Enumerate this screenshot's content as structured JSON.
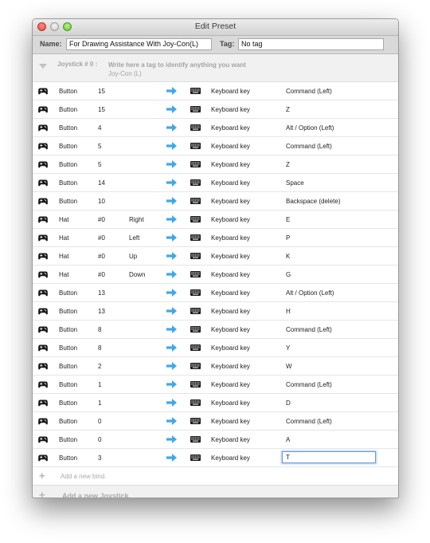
{
  "window": {
    "title": "Edit Preset"
  },
  "preset": {
    "name_label": "Name:",
    "name_value": "For Drawing Assistance With Joy-Con(L)",
    "tag_label": "Tag:",
    "tag_value": "No tag"
  },
  "joystick": {
    "label": "Joystick # 0 :",
    "tag_placeholder": "Write here a tag to identify anything you want",
    "device_name": "Joy-Con (L)"
  },
  "bindings": [
    {
      "type": "Button",
      "number": "15",
      "direction": "",
      "output": "Keyboard key",
      "key": "Command (Left)"
    },
    {
      "type": "Button",
      "number": "15",
      "direction": "",
      "output": "Keyboard key",
      "key": "Z"
    },
    {
      "type": "Button",
      "number": "4",
      "direction": "",
      "output": "Keyboard key",
      "key": "Alt / Option (Left)"
    },
    {
      "type": "Button",
      "number": "5",
      "direction": "",
      "output": "Keyboard key",
      "key": "Command (Left)"
    },
    {
      "type": "Button",
      "number": "5",
      "direction": "",
      "output": "Keyboard key",
      "key": "Z"
    },
    {
      "type": "Button",
      "number": "14",
      "direction": "",
      "output": "Keyboard key",
      "key": "Space"
    },
    {
      "type": "Button",
      "number": "10",
      "direction": "",
      "output": "Keyboard key",
      "key": "Backspace (delete)"
    },
    {
      "type": "Hat",
      "number": "#0",
      "direction": "Right",
      "output": "Keyboard key",
      "key": "E"
    },
    {
      "type": "Hat",
      "number": "#0",
      "direction": "Left",
      "output": "Keyboard key",
      "key": "P"
    },
    {
      "type": "Hat",
      "number": "#0",
      "direction": "Up",
      "output": "Keyboard key",
      "key": "K"
    },
    {
      "type": "Hat",
      "number": "#0",
      "direction": "Down",
      "output": "Keyboard key",
      "key": "G"
    },
    {
      "type": "Button",
      "number": "13",
      "direction": "",
      "output": "Keyboard key",
      "key": "Alt / Option (Left)"
    },
    {
      "type": "Button",
      "number": "13",
      "direction": "",
      "output": "Keyboard key",
      "key": "H"
    },
    {
      "type": "Button",
      "number": "8",
      "direction": "",
      "output": "Keyboard key",
      "key": "Command (Left)"
    },
    {
      "type": "Button",
      "number": "8",
      "direction": "",
      "output": "Keyboard key",
      "key": "Y"
    },
    {
      "type": "Button",
      "number": "2",
      "direction": "",
      "output": "Keyboard key",
      "key": "W"
    },
    {
      "type": "Button",
      "number": "1",
      "direction": "",
      "output": "Keyboard key",
      "key": "Command (Left)"
    },
    {
      "type": "Button",
      "number": "1",
      "direction": "",
      "output": "Keyboard key",
      "key": "D"
    },
    {
      "type": "Button",
      "number": "0",
      "direction": "",
      "output": "Keyboard key",
      "key": "Command (Left)"
    },
    {
      "type": "Button",
      "number": "0",
      "direction": "",
      "output": "Keyboard key",
      "key": "A"
    },
    {
      "type": "Button",
      "number": "3",
      "direction": "",
      "output": "Keyboard key",
      "key": "T",
      "editing": true
    }
  ],
  "add_bind_label": "Add a new bind.",
  "add_joystick_label": "Add a new Joystick.",
  "icons": {
    "input": "gamepad-icon",
    "mapping": "arrow-right-icon",
    "output": "keyboard-icon",
    "add": "plus-icon"
  },
  "colors": {
    "arrow": "#3fa9e8",
    "close": "#e0443a",
    "maximize": "#5ec53a",
    "focus_ring": "#6e9ad6"
  }
}
